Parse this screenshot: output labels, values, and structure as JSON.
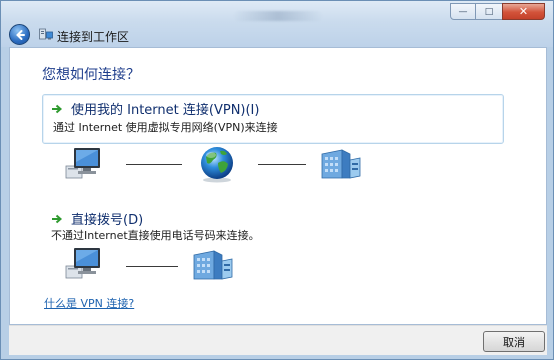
{
  "window": {
    "minimize_glyph": "—",
    "maximize_glyph": "□",
    "close_glyph": "✕"
  },
  "nav": {
    "title": "连接到工作区",
    "back_icon": "back-arrow-icon"
  },
  "main": {
    "question": "您想如何连接？",
    "options": [
      {
        "label": "使用我的 Internet 连接(VPN)(I)",
        "description": "通过 Internet 使用虚拟专用网络(VPN)来连接",
        "selected": true
      },
      {
        "label": "直接拨号(D)",
        "description": "不通过Internet直接使用电话号码来连接。",
        "selected": false
      }
    ],
    "help_link": "什么是 VPN 连接?"
  },
  "footer": {
    "cancel_label": "取消"
  },
  "colors": {
    "heading": "#1f3e8c",
    "link": "#1e63b0",
    "option_arrow": "#2e9a2e",
    "title_bar": "#c9dcef"
  }
}
